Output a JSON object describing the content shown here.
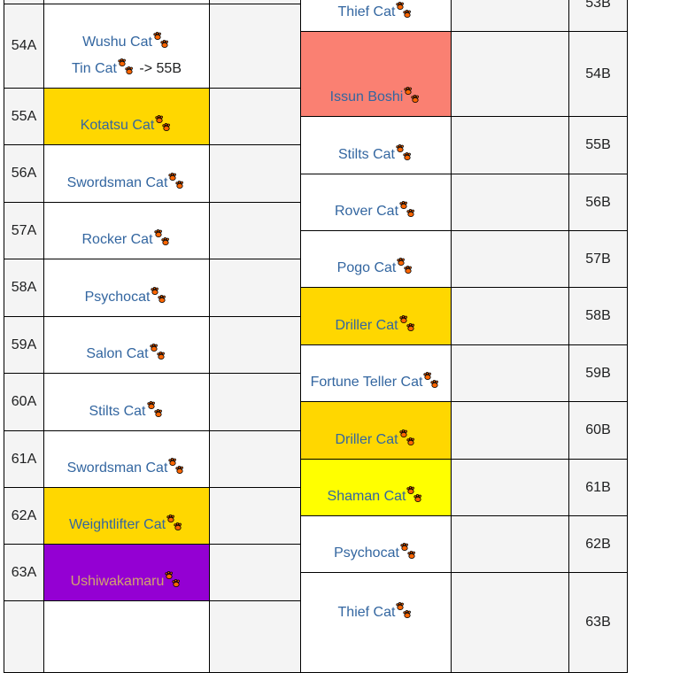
{
  "colors": {
    "link": "#3366a0",
    "yellow_gold": "#ffd700",
    "yellow": "#ffff00",
    "salmon": "#fa8072",
    "purple": "#9400d3",
    "purple_text": "#d2a46e",
    "paw": "#ff6600"
  },
  "icons": {
    "paw": "paw-print-icon"
  },
  "left_table": {
    "rows": [
      {
        "label": "",
        "cats": [],
        "bg": "#ffffff"
      },
      {
        "label": "54A",
        "cats": [
          {
            "name": "Wushu Cat"
          },
          {
            "name": "Tin Cat",
            "suffix": " -> 55B"
          }
        ],
        "bg": "#ffffff"
      },
      {
        "label": "55A",
        "cats": [
          {
            "name": "Kotatsu Cat"
          }
        ],
        "bg": "#ffd700"
      },
      {
        "label": "56A",
        "cats": [
          {
            "name": "Swordsman Cat"
          }
        ],
        "bg": "#ffffff"
      },
      {
        "label": "57A",
        "cats": [
          {
            "name": "Rocker Cat"
          }
        ],
        "bg": "#ffffff"
      },
      {
        "label": "58A",
        "cats": [
          {
            "name": "Psychocat"
          }
        ],
        "bg": "#ffffff"
      },
      {
        "label": "59A",
        "cats": [
          {
            "name": "Salon Cat"
          }
        ],
        "bg": "#ffffff"
      },
      {
        "label": "60A",
        "cats": [
          {
            "name": "Stilts Cat"
          }
        ],
        "bg": "#ffffff"
      },
      {
        "label": "61A",
        "cats": [
          {
            "name": "Swordsman Cat"
          }
        ],
        "bg": "#ffffff"
      },
      {
        "label": "62A",
        "cats": [
          {
            "name": "Weightlifter Cat"
          }
        ],
        "bg": "#ffd700"
      },
      {
        "label": "63A",
        "cats": [
          {
            "name": "Ushiwakamaru",
            "color": "#d2a46e"
          }
        ],
        "bg": "#9400d3"
      },
      {
        "label": "",
        "cats": [],
        "bg": "#ffffff"
      }
    ]
  },
  "right_table": {
    "rows": [
      {
        "label": "53B",
        "cats": [
          {
            "name": "Thief Cat"
          }
        ],
        "bg": "#ffffff"
      },
      {
        "label": "54B",
        "cats": [
          {
            "name": "Issun Boshi"
          }
        ],
        "bg": "#fa8072"
      },
      {
        "label": "55B",
        "cats": [
          {
            "name": "Stilts Cat"
          }
        ],
        "bg": "#ffffff"
      },
      {
        "label": "56B",
        "cats": [
          {
            "name": "Rover Cat"
          }
        ],
        "bg": "#ffffff"
      },
      {
        "label": "57B",
        "cats": [
          {
            "name": "Pogo Cat"
          }
        ],
        "bg": "#ffffff"
      },
      {
        "label": "58B",
        "cats": [
          {
            "name": "Driller Cat"
          }
        ],
        "bg": "#ffd700"
      },
      {
        "label": "59B",
        "cats": [
          {
            "name": "Fortune Teller Cat"
          }
        ],
        "bg": "#ffffff"
      },
      {
        "label": "60B",
        "cats": [
          {
            "name": "Driller Cat"
          }
        ],
        "bg": "#ffd700"
      },
      {
        "label": "61B",
        "cats": [
          {
            "name": "Shaman Cat"
          }
        ],
        "bg": "#ffff00"
      },
      {
        "label": "62B",
        "cats": [
          {
            "name": "Psychocat"
          }
        ],
        "bg": "#ffffff"
      },
      {
        "label": "63B",
        "cats": [
          {
            "name": "Thief Cat"
          }
        ],
        "bg": "#ffffff"
      }
    ]
  }
}
